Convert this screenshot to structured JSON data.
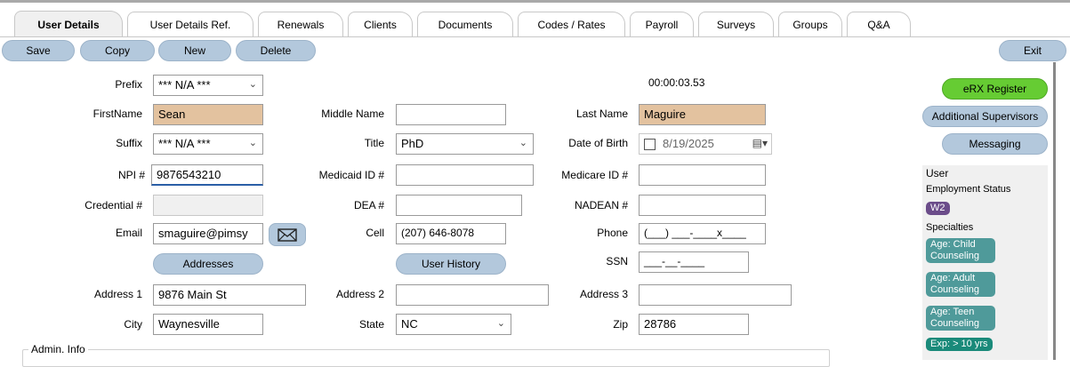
{
  "tabs": [
    {
      "label": "User Details",
      "active": true
    },
    {
      "label": "User Details Ref."
    },
    {
      "label": "Renewals"
    },
    {
      "label": "Clients"
    },
    {
      "label": "Documents"
    },
    {
      "label": "Codes / Rates"
    },
    {
      "label": "Payroll"
    },
    {
      "label": "Surveys"
    },
    {
      "label": "Groups"
    },
    {
      "label": "Q&A"
    }
  ],
  "toolbar": {
    "save": "Save",
    "copy": "Copy",
    "new": "New",
    "delete": "Delete",
    "exit": "Exit"
  },
  "timer": "00:00:03.53",
  "form": {
    "prefix": {
      "label": "Prefix",
      "value": "*** N/A ***"
    },
    "first_name": {
      "label": "FirstName",
      "value": "Sean"
    },
    "middle_name": {
      "label": "Middle Name",
      "value": ""
    },
    "last_name": {
      "label": "Last Name",
      "value": "Maguire"
    },
    "suffix": {
      "label": "Suffix",
      "value": "*** N/A ***"
    },
    "title": {
      "label": "Title",
      "value": "PhD"
    },
    "dob": {
      "label": "Date of Birth",
      "value": "8/19/2025"
    },
    "npi": {
      "label": "NPI #",
      "value": "9876543210"
    },
    "medicaid": {
      "label": "Medicaid ID #",
      "value": ""
    },
    "medicare": {
      "label": "Medicare ID #",
      "value": ""
    },
    "credential": {
      "label": "Credential #",
      "value": ""
    },
    "dea": {
      "label": "DEA #",
      "value": ""
    },
    "nadean": {
      "label": "NADEAN #",
      "value": ""
    },
    "email": {
      "label": "Email",
      "value": "smaguire@pimsy"
    },
    "cell": {
      "label": "Cell",
      "value": "(207) 646-8078"
    },
    "phone": {
      "label": "Phone",
      "value": "(___) ___-____x____"
    },
    "ssn": {
      "label": "SSN",
      "value": "___-__-____"
    },
    "addresses_button": "Addresses",
    "user_history_button": "User History",
    "address1": {
      "label": "Address 1",
      "value": "9876 Main St"
    },
    "address2": {
      "label": "Address 2",
      "value": ""
    },
    "address3": {
      "label": "Address 3",
      "value": ""
    },
    "city": {
      "label": "City",
      "value": "Waynesville"
    },
    "state": {
      "label": "State",
      "value": "NC"
    },
    "zip": {
      "label": "Zip",
      "value": "28786"
    }
  },
  "admin_info": "Admin. Info",
  "sidebar": {
    "erx": "eRX Register",
    "supervisors": "Additional Supervisors",
    "messaging": "Messaging",
    "user": "User",
    "employment_status": "Employment Status",
    "employment_pill": "W2",
    "specialties": "Specialties",
    "specialty_pills": [
      "Age: Child Counseling",
      "Age: Adult Counseling",
      "Age: Teen Counseling",
      "Exp: > 10 yrs"
    ]
  },
  "colors": {
    "button": "#b3c8dc",
    "erx": "#66cc33",
    "required_field": "#e3c29f",
    "pill_purple": "#6b4c8a",
    "pill_teal": "#4f9a9a",
    "pill_darkteal": "#1a8a7a"
  }
}
